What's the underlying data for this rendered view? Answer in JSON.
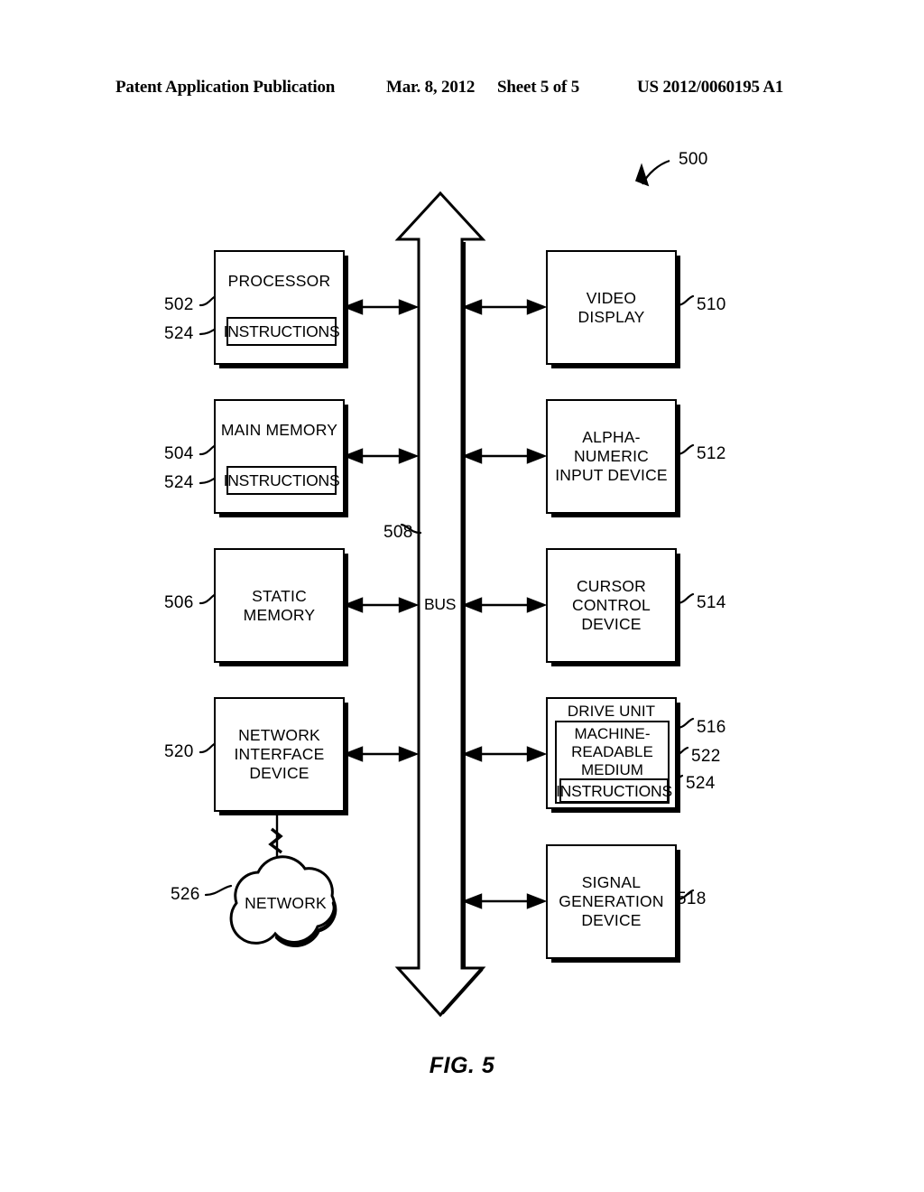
{
  "header": {
    "left": "Patent Application Publication",
    "date": "Mar. 8, 2012",
    "sheet": "Sheet 5 of 5",
    "patent_number": "US 2012/0060195 A1"
  },
  "figure": {
    "caption": "FIG. 5",
    "system_ref": "500",
    "bus": {
      "label": "BUS",
      "ref": "508"
    },
    "left_column": [
      {
        "name": "processor",
        "label": "PROCESSOR",
        "ref": "502",
        "sub": {
          "label": "INSTRUCTIONS",
          "ref": "524"
        }
      },
      {
        "name": "main-memory",
        "label": "MAIN MEMORY",
        "ref": "504",
        "sub": {
          "label": "INSTRUCTIONS",
          "ref": "524"
        }
      },
      {
        "name": "static-memory",
        "label": "STATIC\nMEMORY",
        "ref": "506",
        "sub": null
      },
      {
        "name": "network-interface-device",
        "label": "NETWORK\nINTERFACE\nDEVICE",
        "ref": "520",
        "sub": null
      }
    ],
    "right_column": [
      {
        "name": "video-display",
        "label": "VIDEO\nDISPLAY",
        "ref": "510"
      },
      {
        "name": "alpha-numeric-input-device",
        "label": "ALPHA-NUMERIC\nINPUT DEVICE",
        "ref": "512"
      },
      {
        "name": "cursor-control-device",
        "label": "CURSOR\nCONTROL\nDEVICE",
        "ref": "514"
      },
      {
        "name": "signal-generation-device",
        "label": "SIGNAL\nGENERATION\nDEVICE",
        "ref": "518"
      }
    ],
    "drive_unit": {
      "title": "DRIVE UNIT",
      "ref": "516",
      "medium": {
        "label": "MACHINE-\nREADABLE\nMEDIUM",
        "ref": "522"
      },
      "instructions": {
        "label": "INSTRUCTIONS",
        "ref": "524"
      }
    },
    "network": {
      "label": "NETWORK",
      "ref": "526"
    }
  },
  "colors": {
    "ink": "#000000",
    "paper": "#ffffff"
  }
}
